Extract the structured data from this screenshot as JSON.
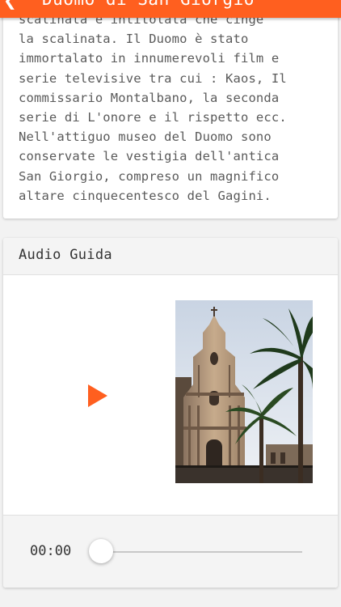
{
  "header": {
    "back_icon": "chevron-left-icon",
    "title": "Duomo di San Giorgio",
    "color": "#ff5f1f"
  },
  "description": {
    "lines": [
      "scalinata e intitolata che cinge",
      "la scalinata. Il Duomo è stato",
      "immortalato in innumerevoli film e",
      "serie televisive tra cui : Kaos, Il",
      "commissario Montalbano, la seconda",
      "serie di L'onore e il rispetto ecc.",
      "Nell'attiguo museo del Duomo sono",
      "conservate le vestigia dell'antica",
      "San Giorgio, compreso un magnifico",
      "altare cinquecentesco del Gagini."
    ]
  },
  "audio": {
    "title": "Audio Guida",
    "play_icon": "play-icon",
    "play_color": "#ff5f1f",
    "time": "00:00",
    "progress": 0
  }
}
